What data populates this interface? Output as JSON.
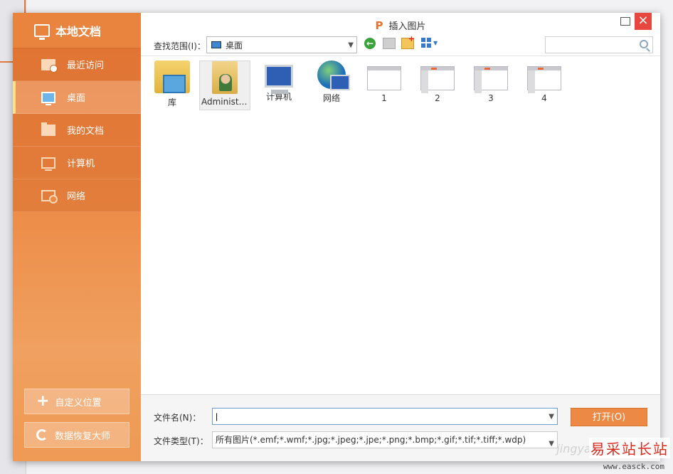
{
  "sidebar": {
    "title": "本地文档",
    "items": [
      {
        "label": "最近访问",
        "icon": "recent-folder-icon"
      },
      {
        "label": "桌面",
        "icon": "desktop-icon",
        "active": true
      },
      {
        "label": "我的文档",
        "icon": "documents-folder-icon"
      },
      {
        "label": "计算机",
        "icon": "computer-icon"
      },
      {
        "label": "网络",
        "icon": "network-icon"
      }
    ],
    "custom_location_label": "自定义位置",
    "data_recovery_label": "数据恢复大师"
  },
  "dialog": {
    "title": "插入图片",
    "logo_glyph": "P"
  },
  "toolbar": {
    "range_label": "查找范围(I)：",
    "range_value": "桌面",
    "search_placeholder": ""
  },
  "files": [
    {
      "label": "库",
      "icon": "library-folder-icon"
    },
    {
      "label": "Administr...",
      "icon": "user-folder-icon",
      "selected": true
    },
    {
      "label": "计算机",
      "icon": "computer-icon"
    },
    {
      "label": "网络",
      "icon": "network-globe-icon"
    },
    {
      "label": "1",
      "icon": "slide-thumbnail-icon"
    },
    {
      "label": "2",
      "icon": "slide-thumbnail-icon"
    },
    {
      "label": "3",
      "icon": "slide-thumbnail-icon"
    },
    {
      "label": "4",
      "icon": "slide-thumbnail-icon"
    }
  ],
  "bottom": {
    "filename_label": "文件名(N)：",
    "filename_value": "|",
    "filetype_label": "文件类型(T)：",
    "filetype_value": "所有图片(*.emf;*.wmf;*.jpg;*.jpeg;*.jpe;*.png;*.bmp;*.gif;*.tif;*.tiff;*.wdp)",
    "open_label": "打开(O)"
  },
  "watermark": {
    "faint_text": "jingyan.ba",
    "text": "易采站长站",
    "url": "www.easck.com"
  },
  "colors": {
    "accent": "#ec8a45",
    "close": "#e8473f"
  }
}
